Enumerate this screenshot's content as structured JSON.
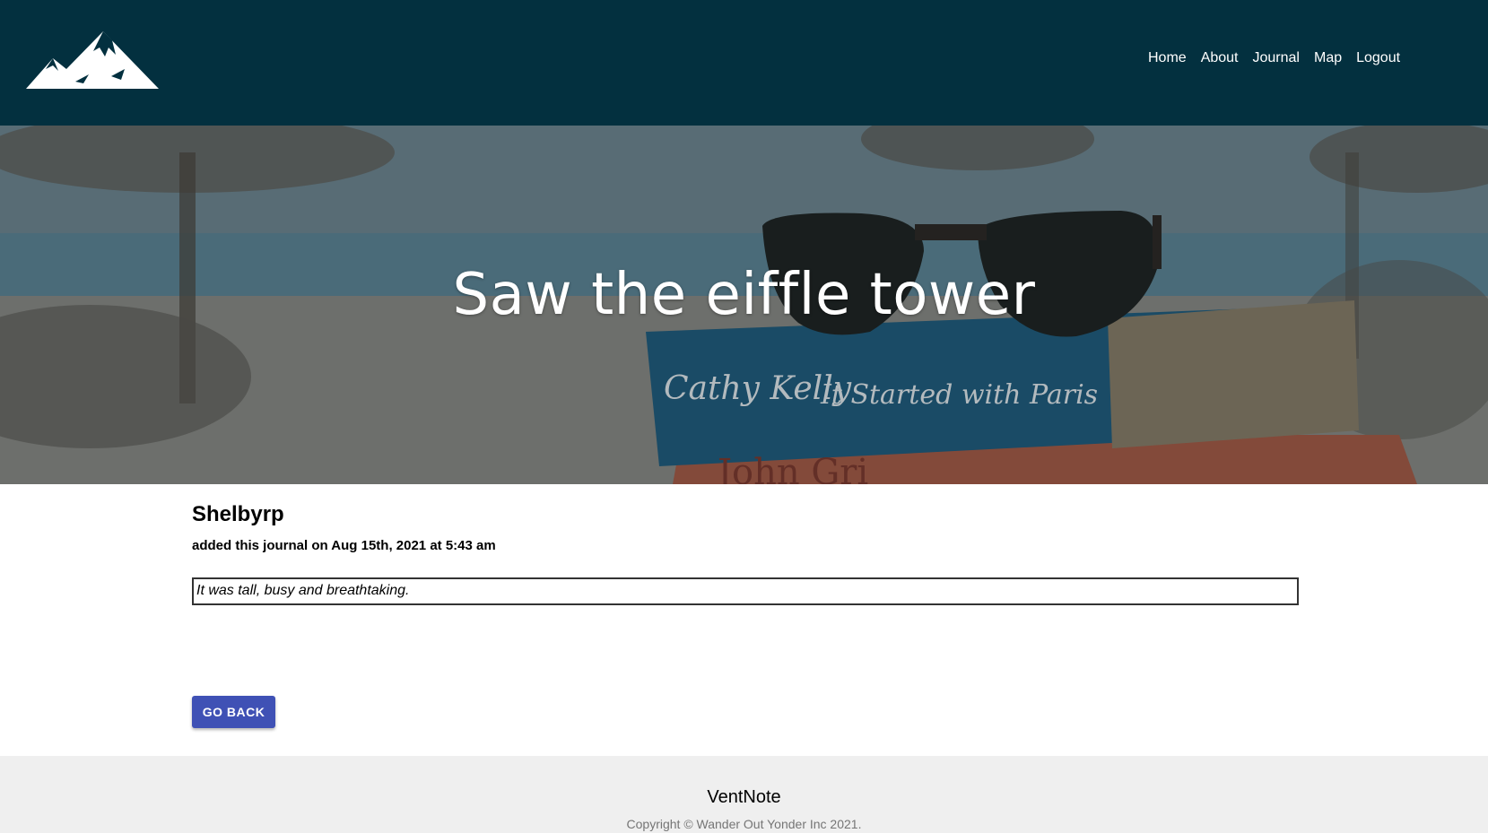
{
  "header": {
    "logo": "mountain-logo",
    "nav": [
      "Home",
      "About",
      "Journal",
      "Map",
      "Logout"
    ]
  },
  "hero": {
    "title": "Saw the eiffle tower",
    "image_text": [
      "Cathy Kelly",
      "It Started with Paris",
      "John Gri"
    ]
  },
  "journal": {
    "author": "Shelbyrp",
    "meta": "added this journal on Aug 15th, 2021 at 5:43 am",
    "entry": "It was tall, busy and breathtaking.",
    "back_label": "GO BACK"
  },
  "footer": {
    "brand": "VentNote",
    "copyright": "Copyright © Wander Out Yonder Inc 2021."
  },
  "colors": {
    "header_bg": "#03303f",
    "button_bg": "#3f51b5",
    "footer_bg": "#efefef"
  }
}
